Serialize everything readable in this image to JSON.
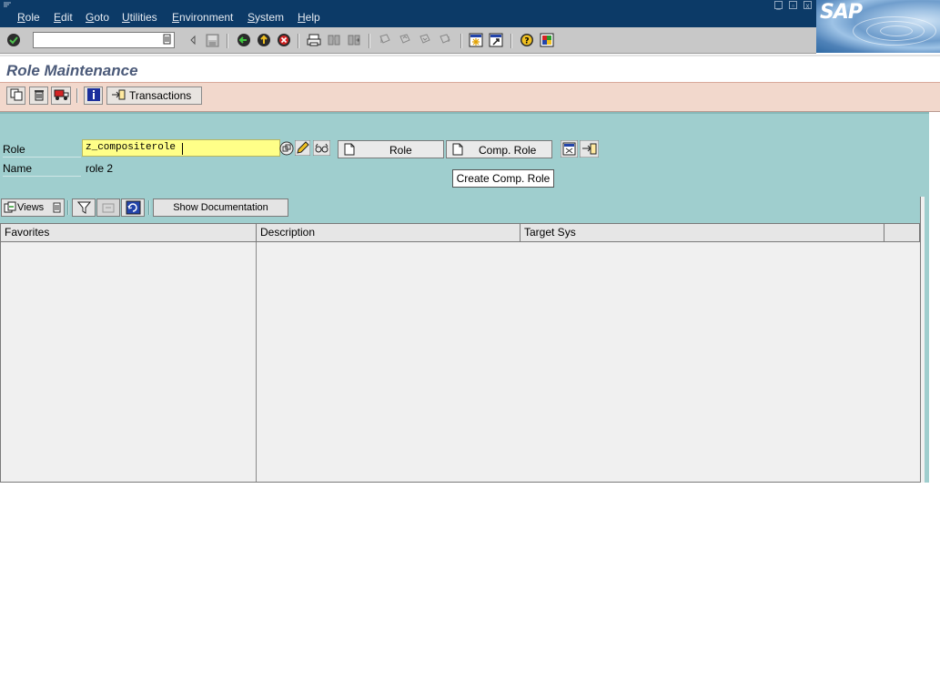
{
  "menu": {
    "items": [
      "Role",
      "Edit",
      "Goto",
      "Utilities",
      "Environment",
      "System",
      "Help"
    ]
  },
  "logo_text": "SAP",
  "command_field": {
    "value": ""
  },
  "page": {
    "title": "Role Maintenance"
  },
  "app_toolbar": {
    "transactions_label": "Transactions"
  },
  "form": {
    "role_label": "Role",
    "role_value": "z_compositerole",
    "name_label": "Name",
    "name_value": "role 2",
    "role_button": "Role",
    "comp_role_button": "Comp. Role",
    "tooltip": "Create Comp. Role"
  },
  "tree_toolbar": {
    "views_label": "Views",
    "show_doc_label": "Show Documentation"
  },
  "tree": {
    "columns": [
      "Favorites",
      "Description",
      "Target Sys",
      ""
    ]
  },
  "colors": {
    "menubar": "#0c3a67",
    "app_toolbar": "#f2d8cc",
    "main_background": "#9fcece",
    "input_highlight": "#ffff88"
  },
  "icons": {
    "toolbar": [
      "enter-icon",
      "back-icon",
      "exit-icon",
      "cancel-icon",
      "print-icon",
      "find-icon",
      "find-next-icon",
      "first-page-icon",
      "previous-page-icon",
      "next-page-icon",
      "last-page-icon",
      "create-session-icon",
      "shortcut-icon",
      "help-icon",
      "layout-icon"
    ],
    "app": [
      "copy-icon",
      "delete-icon",
      "transport-icon",
      "info-icon",
      "transactions-icon"
    ]
  }
}
